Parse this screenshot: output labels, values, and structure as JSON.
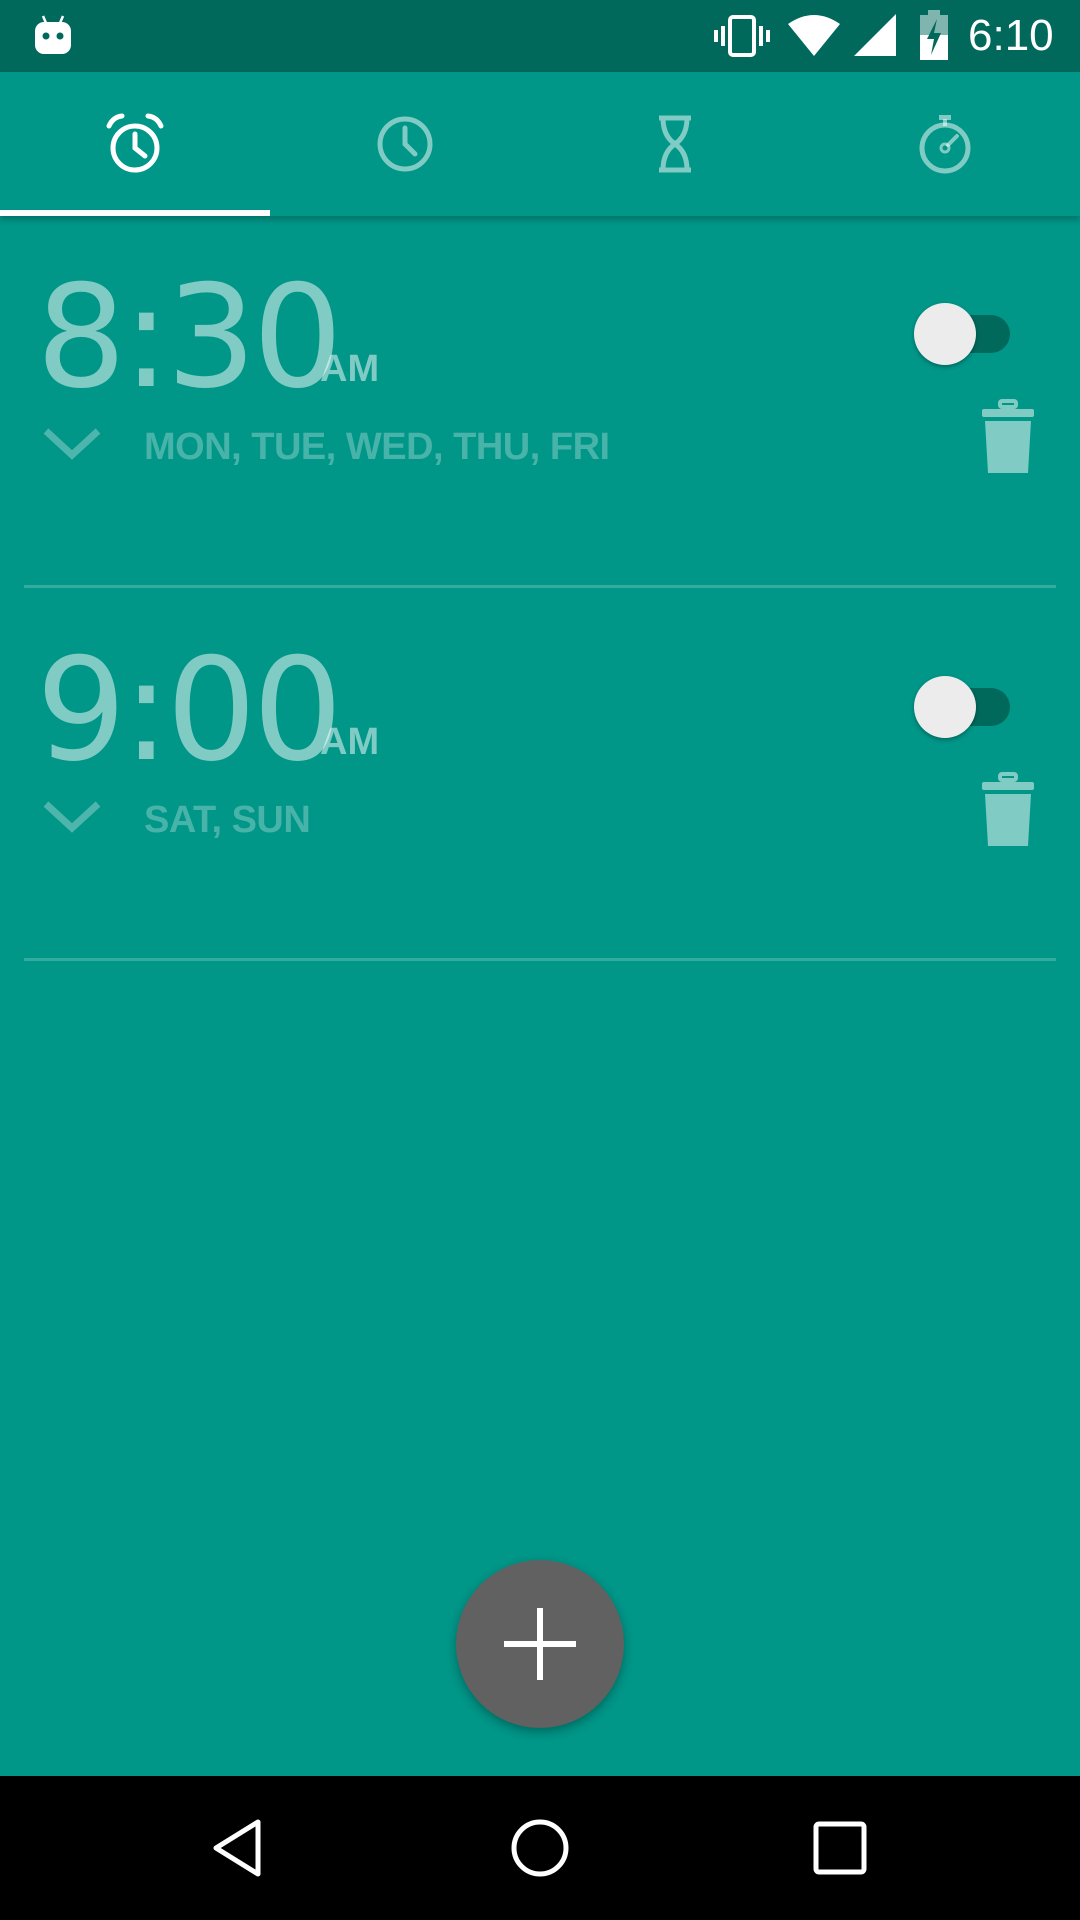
{
  "status_bar": {
    "time": "6:10",
    "icons": [
      "android-robot-icon",
      "vibrate-icon",
      "wifi-icon",
      "signal-icon",
      "battery-charging-icon"
    ]
  },
  "tabs": [
    {
      "name": "alarm",
      "icon": "alarm-clock-icon",
      "selected": true
    },
    {
      "name": "clock",
      "icon": "clock-icon",
      "selected": false
    },
    {
      "name": "timer",
      "icon": "hourglass-icon",
      "selected": false
    },
    {
      "name": "stopwatch",
      "icon": "stopwatch-icon",
      "selected": false
    }
  ],
  "alarms": [
    {
      "time": "8:30",
      "ampm": "AM",
      "days": "MON, TUE, WED, THU, FRI",
      "enabled": false
    },
    {
      "time": "9:00",
      "ampm": "AM",
      "days": "SAT, SUN",
      "enabled": false
    }
  ],
  "fab": {
    "icon": "plus-icon"
  },
  "nav_bar": {
    "icons": [
      "back-icon",
      "home-icon",
      "recents-icon"
    ]
  },
  "colors": {
    "background": "#009688",
    "status_bar": "#00695C",
    "fab": "#616161",
    "switch_track_off": "#00695C",
    "switch_thumb_off": "#ECECEC"
  }
}
